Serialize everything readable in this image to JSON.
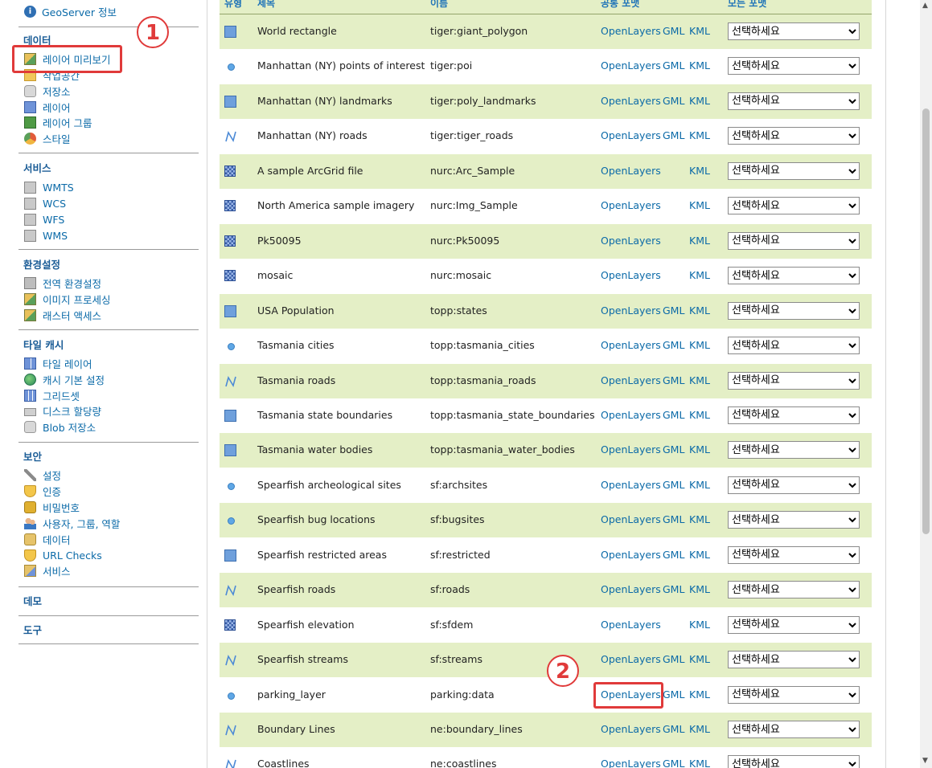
{
  "sidebar": {
    "top_link": "GeoServer 정보",
    "sections": [
      {
        "heading": "데이터",
        "items": [
          "레이어 미리보기",
          "작업공간",
          "저장소",
          "레이어",
          "레이어 그룹",
          "스타일"
        ]
      },
      {
        "heading": "서비스",
        "items": [
          "WMTS",
          "WCS",
          "WFS",
          "WMS"
        ]
      },
      {
        "heading": "환경설정",
        "items": [
          "전역 환경설정",
          "이미지 프로세싱",
          "래스터 액세스"
        ]
      },
      {
        "heading": "타일 캐시",
        "items": [
          "타일 레이어",
          "캐시 기본 설정",
          "그리드셋",
          "디스크 할당량",
          "Blob 저장소"
        ]
      },
      {
        "heading": "보안",
        "items": [
          "설정",
          "인증",
          "비밀번호",
          "사용자, 그룹, 역할",
          "데이터",
          "URL Checks",
          "서비스"
        ]
      },
      {
        "heading": "데모",
        "items": []
      },
      {
        "heading": "도구",
        "items": []
      }
    ]
  },
  "table": {
    "headers": [
      "유형",
      "제목",
      "이름",
      "공통 포맷",
      "모든 포맷"
    ],
    "link_labels": {
      "openlayers": "OpenLayers",
      "gml": "GML",
      "kml": "KML"
    },
    "select_placeholder": "선택하세요",
    "rows": [
      {
        "type": "polygon",
        "title": "World rectangle",
        "name": "tiger:giant_polygon",
        "gml": true
      },
      {
        "type": "point",
        "title": "Manhattan (NY) points of interest",
        "name": "tiger:poi",
        "gml": true
      },
      {
        "type": "polygon",
        "title": "Manhattan (NY) landmarks",
        "name": "tiger:poly_landmarks",
        "gml": true
      },
      {
        "type": "line",
        "title": "Manhattan (NY) roads",
        "name": "tiger:tiger_roads",
        "gml": true
      },
      {
        "type": "raster",
        "title": "A sample ArcGrid file",
        "name": "nurc:Arc_Sample",
        "gml": false
      },
      {
        "type": "raster",
        "title": "North America sample imagery",
        "name": "nurc:Img_Sample",
        "gml": false
      },
      {
        "type": "raster",
        "title": "Pk50095",
        "name": "nurc:Pk50095",
        "gml": false
      },
      {
        "type": "raster",
        "title": "mosaic",
        "name": "nurc:mosaic",
        "gml": false
      },
      {
        "type": "polygon",
        "title": "USA Population",
        "name": "topp:states",
        "gml": true
      },
      {
        "type": "point",
        "title": "Tasmania cities",
        "name": "topp:tasmania_cities",
        "gml": true
      },
      {
        "type": "line",
        "title": "Tasmania roads",
        "name": "topp:tasmania_roads",
        "gml": true
      },
      {
        "type": "polygon",
        "title": "Tasmania state boundaries",
        "name": "topp:tasmania_state_boundaries",
        "gml": true
      },
      {
        "type": "polygon",
        "title": "Tasmania water bodies",
        "name": "topp:tasmania_water_bodies",
        "gml": true
      },
      {
        "type": "point",
        "title": "Spearfish archeological sites",
        "name": "sf:archsites",
        "gml": true
      },
      {
        "type": "point",
        "title": "Spearfish bug locations",
        "name": "sf:bugsites",
        "gml": true
      },
      {
        "type": "polygon",
        "title": "Spearfish restricted areas",
        "name": "sf:restricted",
        "gml": true
      },
      {
        "type": "line",
        "title": "Spearfish roads",
        "name": "sf:roads",
        "gml": true
      },
      {
        "type": "raster",
        "title": "Spearfish elevation",
        "name": "sf:sfdem",
        "gml": false
      },
      {
        "type": "line",
        "title": "Spearfish streams",
        "name": "sf:streams",
        "gml": true
      },
      {
        "type": "point",
        "title": "parking_layer",
        "name": "parking:data",
        "gml": true
      },
      {
        "type": "line",
        "title": "Boundary Lines",
        "name": "ne:boundary_lines",
        "gml": true
      },
      {
        "type": "line",
        "title": "Coastlines",
        "name": "ne:coastlines",
        "gml": true
      }
    ]
  },
  "annotations": {
    "step1": "1",
    "step2": "2"
  },
  "colors": {
    "accent": "#0b6aa8",
    "row_stripe": "#e4efc6",
    "highlight": "#e03a3a"
  }
}
